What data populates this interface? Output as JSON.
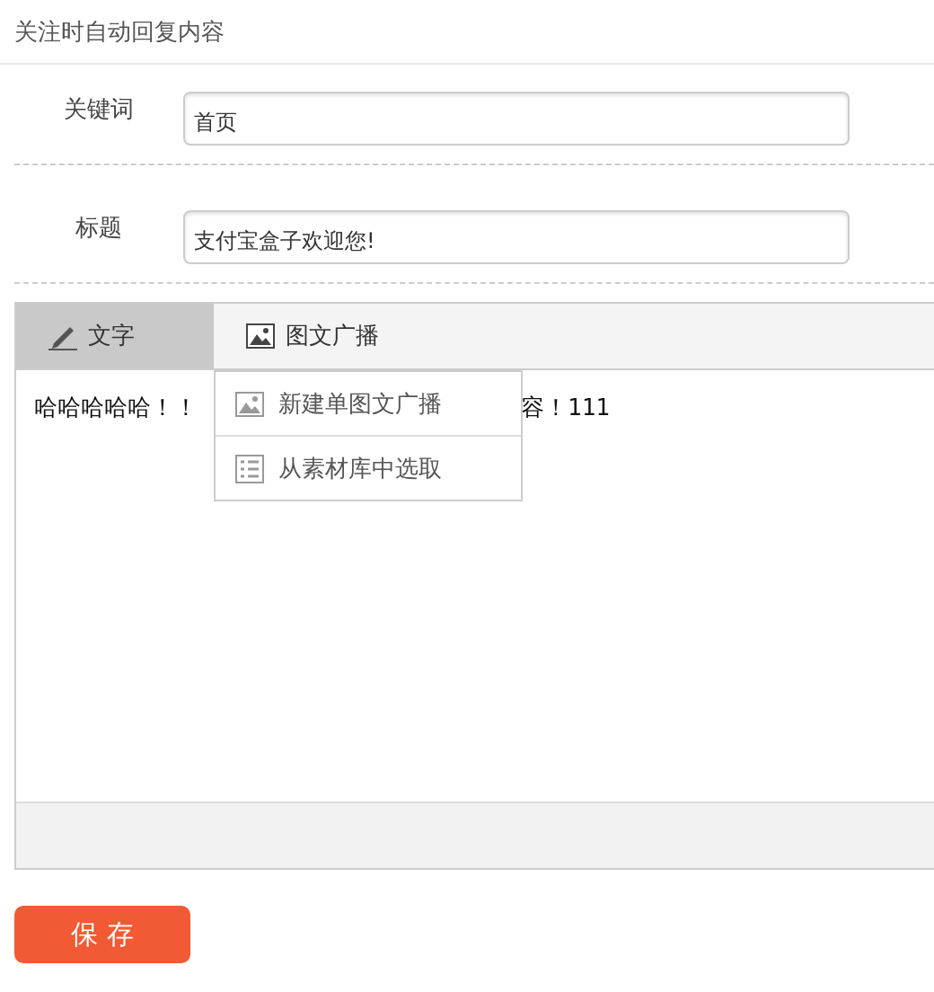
{
  "section_title": "关注时自动回复内容",
  "fields": [
    {
      "label": "关键词",
      "value": "首页"
    },
    {
      "label": "标题",
      "value": "支付宝盒子欢迎您!"
    }
  ],
  "editor": {
    "tabs": [
      {
        "label": "文字",
        "kind": "text",
        "selected": true
      },
      {
        "label": "图文广播",
        "kind": "image",
        "selected": false
      }
    ],
    "menu": [
      {
        "label": "新建单图文广播",
        "kind": "image"
      },
      {
        "label": "从素材库中选取",
        "kind": "list"
      }
    ],
    "content": [
      "哈哈哈哈哈！！",
      "容！111"
    ]
  },
  "save_button": "保 存"
}
